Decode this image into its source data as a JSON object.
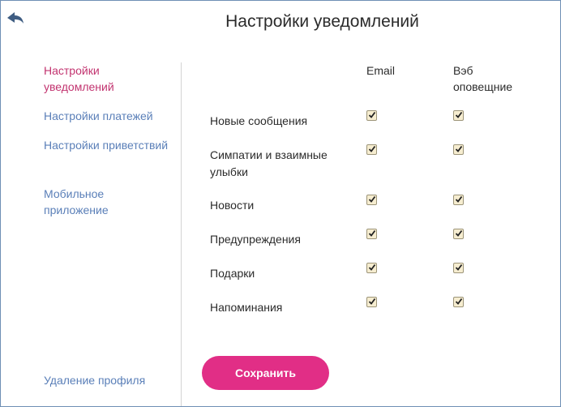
{
  "header": {
    "back_icon": "back-arrow-icon",
    "title": "Настройки уведомлений"
  },
  "sidebar": {
    "items": [
      {
        "label": "Настройки уведомлений",
        "active": true
      },
      {
        "label": "Настройки платежей",
        "active": false
      },
      {
        "label": "Настройки приветствий",
        "active": false
      },
      {
        "label": "Мобильное приложение",
        "active": false
      }
    ],
    "delete_label": "Удаление профиля"
  },
  "table": {
    "columns": [
      "Email",
      "Вэб оповещние"
    ],
    "rows": [
      {
        "label": "Новые сообщения",
        "email": true,
        "web": true
      },
      {
        "label": "Симпатии и взаимные улыбки",
        "email": true,
        "web": true
      },
      {
        "label": "Новости",
        "email": true,
        "web": true
      },
      {
        "label": "Предупреждения",
        "email": true,
        "web": true
      },
      {
        "label": "Подарки",
        "email": true,
        "web": true
      },
      {
        "label": "Напоминания",
        "email": true,
        "web": true
      }
    ]
  },
  "save_label": "Сохранить",
  "colors": {
    "accent": "#e12e86",
    "active_link": "#c2336f",
    "link": "#5a7fb8",
    "frame": "#6f8fb5",
    "checkbox_bg": "#f6edd0"
  }
}
